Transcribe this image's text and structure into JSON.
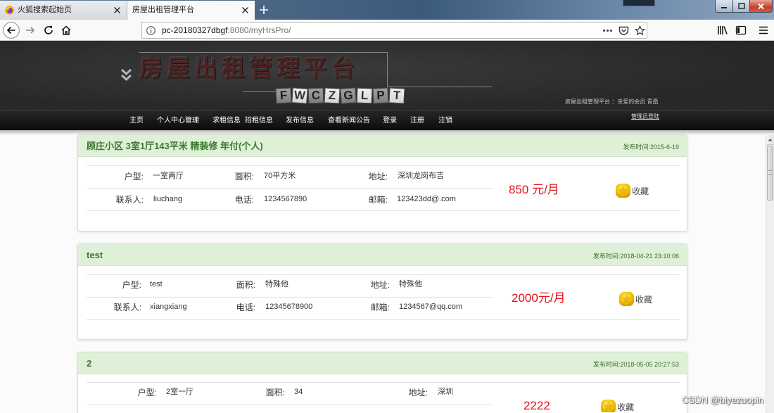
{
  "browser": {
    "tabs": [
      {
        "label": "火狐搜索起始页",
        "favicon": "firefox-icon"
      },
      {
        "label": "房屋出租管理平台",
        "active": true
      }
    ],
    "url": {
      "host": "pc-20180327dbgf",
      "rest": ":8080/myHrsPro/"
    },
    "toolbar_icons": [
      "back-arrow-icon",
      "forward-arrow-icon",
      "reload-icon",
      "home-icon",
      "info-icon",
      "more-dots-icon",
      "pocket-icon",
      "bookmark-star-icon",
      "library-icon",
      "sidebar-icon",
      "hamburger-menu-icon"
    ],
    "window_controls": [
      "minimize-icon",
      "maximize-icon",
      "close-icon"
    ]
  },
  "site": {
    "title": "房屋出租管理平台",
    "logo_letters": [
      "F",
      "W",
      "C",
      "Z",
      "G",
      "L",
      "P",
      "T"
    ],
    "greeting": "房屋出租管理平台 ：亲爱的会员 青凰",
    "nav": [
      "主页",
      "个人中心管理",
      "求租信息",
      "招租信息",
      "发布信息",
      "查看新闻公告",
      "登录",
      "注册",
      "注销"
    ],
    "admin_login": "管理员登陆"
  },
  "field_labels": {
    "unit_type": "户型:",
    "area": "面积:",
    "address": "地址:",
    "contact": "联系人:",
    "phone": "电话:",
    "email": "邮箱:"
  },
  "favorite_label": "收藏",
  "listings": [
    {
      "title": "顾庄小区 3室1厅143平米 精装修 年付(个人)",
      "date": "发布时间:2015-6-19",
      "unit_type": "一室两厅",
      "area": "70平方米",
      "address": "深圳龙岗布吉",
      "contact": "liuchang",
      "phone": "1234567890",
      "email": "123423dd@.com",
      "price": "850 元/月"
    },
    {
      "title": "test",
      "date": "发布时间:2018-04-21 23:10:06",
      "unit_type": "test",
      "area": "特殊他",
      "address": "特殊他",
      "contact": "xiangxiang",
      "phone": "12345678900",
      "email": "1234567@qq.com",
      "price": "2000元/月"
    },
    {
      "title": "2",
      "date": "发布时间:2018-05-05 20:27:53",
      "unit_type": "2室一厅",
      "area": "34",
      "address": "深圳",
      "price": "2222"
    }
  ],
  "watermark": "CSDN @biyezuopin",
  "colors": {
    "site_header": "#2b2b2b",
    "site_nav": "#111111",
    "card_header": "#dff0d8",
    "card_title": "#3c7a2e",
    "price": "#e3121b",
    "favorite_icon": "#f5c400"
  }
}
